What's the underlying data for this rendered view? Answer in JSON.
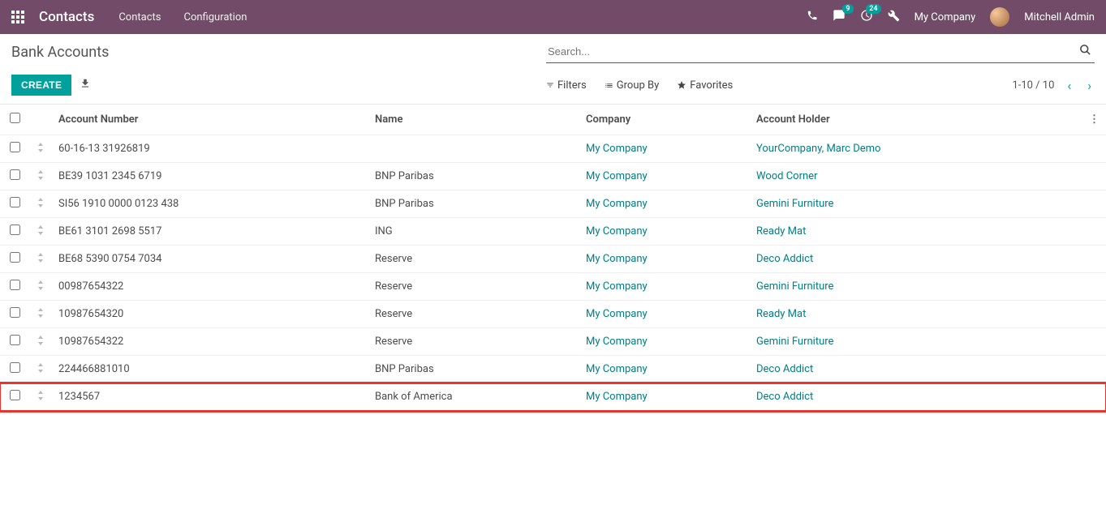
{
  "nav": {
    "brand": "Contacts",
    "menu": [
      "Contacts",
      "Configuration"
    ],
    "msg_badge": "9",
    "act_badge": "24",
    "company": "My Company",
    "user": "Mitchell Admin"
  },
  "page": {
    "title": "Bank Accounts",
    "create": "CREATE",
    "search_placeholder": "Search..."
  },
  "toolbar": {
    "filters": "Filters",
    "groupby": "Group By",
    "favorites": "Favorites",
    "pager": "1-10 / 10"
  },
  "columns": {
    "account": "Account Number",
    "name": "Name",
    "company": "Company",
    "holder": "Account Holder"
  },
  "rows": [
    {
      "account": "60-16-13 31926819",
      "name": "",
      "company": "My Company",
      "holder": "YourCompany, Marc Demo"
    },
    {
      "account": "BE39 1031 2345 6719",
      "name": "BNP Paribas",
      "company": "My Company",
      "holder": "Wood Corner"
    },
    {
      "account": "SI56 1910 0000 0123 438",
      "name": "BNP Paribas",
      "company": "My Company",
      "holder": "Gemini Furniture"
    },
    {
      "account": "BE61 3101 2698 5517",
      "name": "ING",
      "company": "My Company",
      "holder": "Ready Mat"
    },
    {
      "account": "BE68 5390 0754 7034",
      "name": "Reserve",
      "company": "My Company",
      "holder": "Deco Addict"
    },
    {
      "account": "00987654322",
      "name": "Reserve",
      "company": "My Company",
      "holder": "Gemini Furniture"
    },
    {
      "account": "10987654320",
      "name": "Reserve",
      "company": "My Company",
      "holder": "Ready Mat"
    },
    {
      "account": "10987654322",
      "name": "Reserve",
      "company": "My Company",
      "holder": "Gemini Furniture"
    },
    {
      "account": "224466881010",
      "name": "BNP Paribas",
      "company": "My Company",
      "holder": "Deco Addict"
    },
    {
      "account": "1234567",
      "name": "Bank of America",
      "company": "My Company",
      "holder": "Deco Addict"
    }
  ],
  "highlight_index": 9
}
